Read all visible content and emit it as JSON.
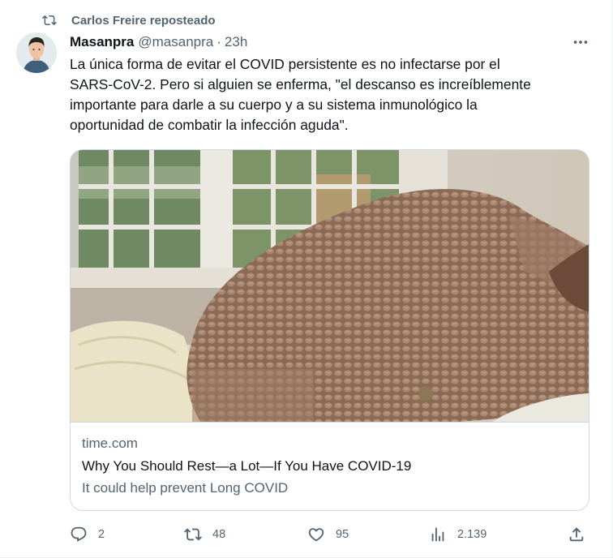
{
  "repost": {
    "label": "Carlos Freire reposteado"
  },
  "author": {
    "name": "Masanpra",
    "handle": "@masanpra",
    "separator": "·",
    "time": "23h"
  },
  "tweet": {
    "text": "La única forma de evitar el COVID persistente es no infectarse por el\nSARS-CoV-2. Pero si alguien se enferma, \"el descanso es increíblemente\nimportante para darle a su cuerpo y a su sistema inmunológico la\noportunidad de combatir la infección aguda\"."
  },
  "card": {
    "domain": "time.com",
    "title": "Why You Should Rest—a Lot—If You Have COVID-19",
    "description": "It could help prevent Long COVID"
  },
  "actions": {
    "replies": "2",
    "reposts": "48",
    "likes": "95",
    "views": "2.139"
  },
  "icons": {
    "repost": "repost-icon",
    "more": "more-icon",
    "reply": "reply-icon",
    "like": "heart-icon",
    "views": "views-icon",
    "share": "share-icon"
  }
}
